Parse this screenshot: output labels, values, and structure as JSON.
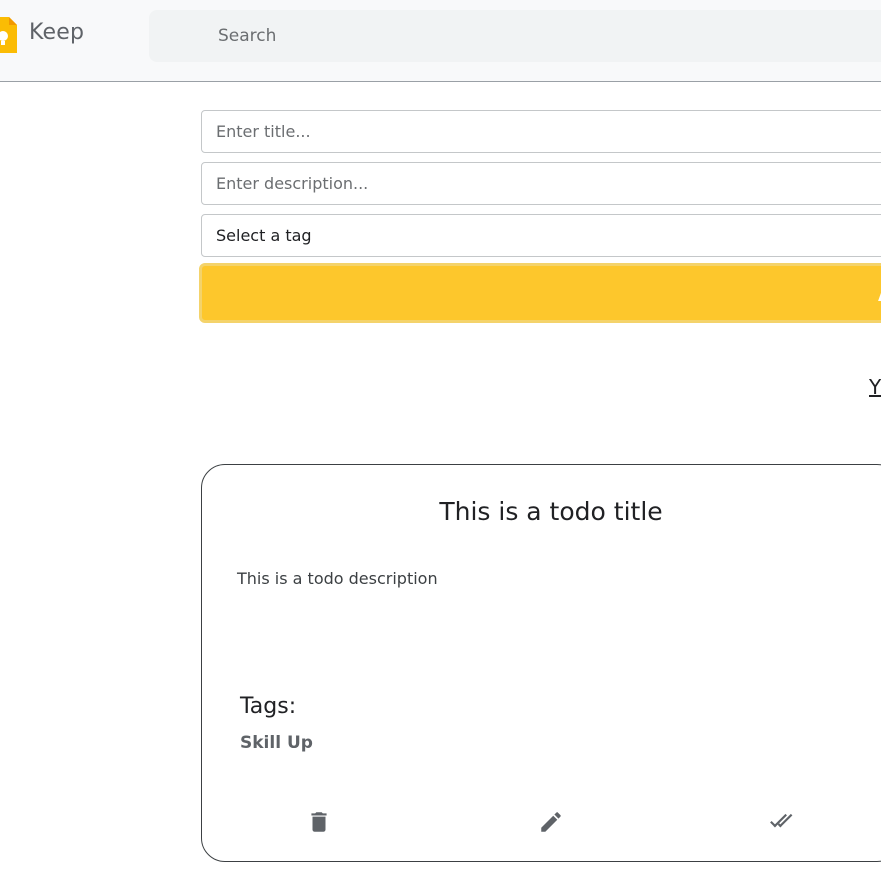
{
  "header": {
    "brand": "Keep",
    "search_placeholder": "Search"
  },
  "form": {
    "title_placeholder": "Enter title...",
    "description_placeholder": "Enter description...",
    "tag_select_value": "Select a tag",
    "add_button_label_fragment": "A"
  },
  "link_fragment": "Y",
  "note": {
    "title": "This is a todo title",
    "description": "This is a todo description",
    "tags_label": "Tags:",
    "tags": [
      "Skill Up"
    ]
  },
  "icons": {
    "logo": "keep-logo-icon",
    "delete": "trash-icon",
    "edit": "pencil-icon",
    "complete": "double-check-icon"
  },
  "colors": {
    "accent": "#fdc72c",
    "accent_border": "#f4d36b",
    "icon_gray": "#5f6368"
  }
}
